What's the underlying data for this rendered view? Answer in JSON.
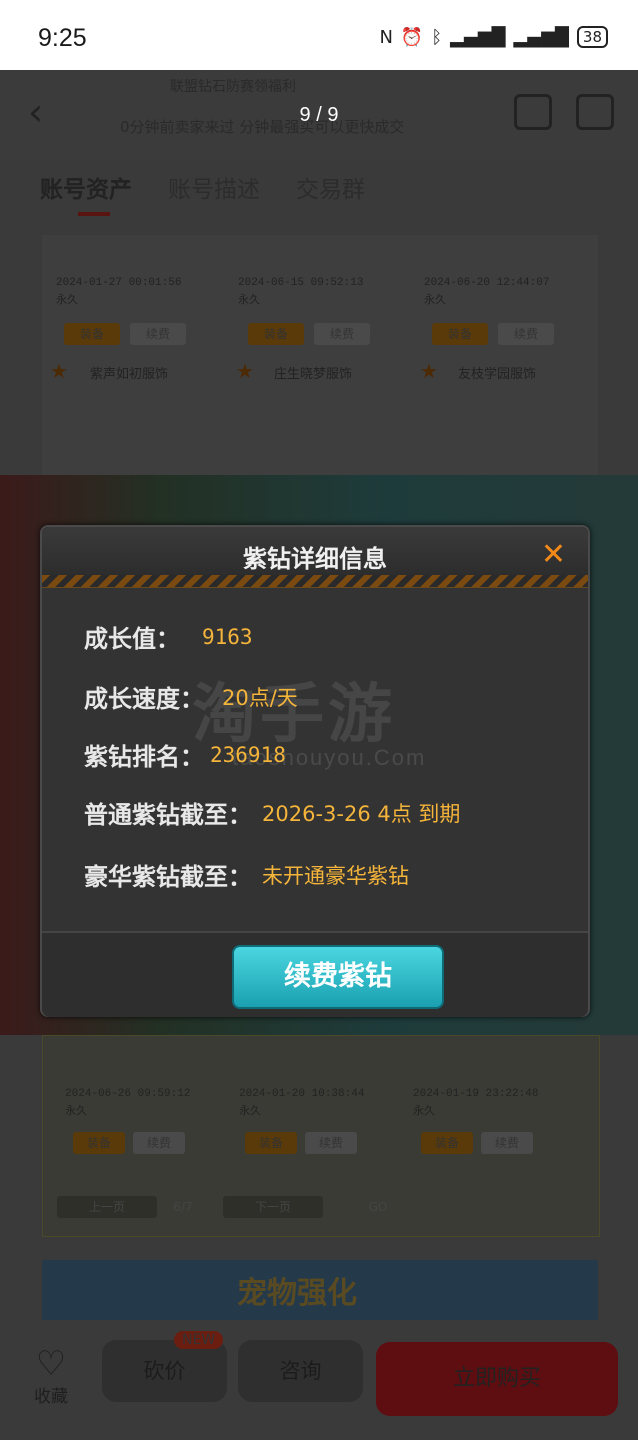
{
  "status_bar": {
    "time": "9:25",
    "battery": "38"
  },
  "header": {
    "image_counter": "9 / 9",
    "line1": "联盟钻石防赛领福利",
    "line2": "0分钟前卖家来过 分钟最强买可以更快成交"
  },
  "tabs": [
    {
      "label": "账号资产",
      "active": true
    },
    {
      "label": "账号描述",
      "active": false
    },
    {
      "label": "交易群",
      "active": false
    }
  ],
  "upper_grid": {
    "timestamps": [
      "2024-01-27 00:01:56",
      "2024-06-15 09:52:13",
      "2024-06-20 12:44:07"
    ],
    "duration": "永久",
    "equip_label": "装备",
    "renew_label": "续费",
    "items": [
      "紫声如初服饰",
      "庄生晓梦服饰",
      "友枝学园服饰"
    ]
  },
  "lower_grid": {
    "timestamps": [
      "2024-06-26 09:59:12",
      "2024-01-20 10:38:44",
      "2024-01-19 23:22:48"
    ],
    "duration": "永久",
    "prev": "上一页",
    "page": "6/7",
    "next": "下一页",
    "go": "GO"
  },
  "banner_text": "宠物强化",
  "dialog": {
    "title": "紫钻详细信息",
    "close": "✕",
    "rows": [
      {
        "label": "成长值：",
        "value": "9163"
      },
      {
        "label": "成长速度：",
        "value": "20点/天"
      },
      {
        "label": "紫钻排名：",
        "value": "236918"
      },
      {
        "label": "普通紫钻截至：",
        "value": "2026-3-26 4点 到期"
      },
      {
        "label": "豪华紫钻截至：",
        "value": "未开通豪华紫钻"
      }
    ],
    "watermark": "淘手游",
    "watermark_url": "taoshouyou.Com",
    "renew_button": "续费紫钻"
  },
  "bottom_bar": {
    "favorite": "收藏",
    "bargain": "砍价",
    "new_tag": "NEW",
    "consult": "咨询",
    "buy_now": "立即购买"
  },
  "colors": {
    "dialog_value": "#f5b43a",
    "close": "#f28a1a",
    "renew": "#2ab8c8",
    "buy": "#e0252b"
  }
}
